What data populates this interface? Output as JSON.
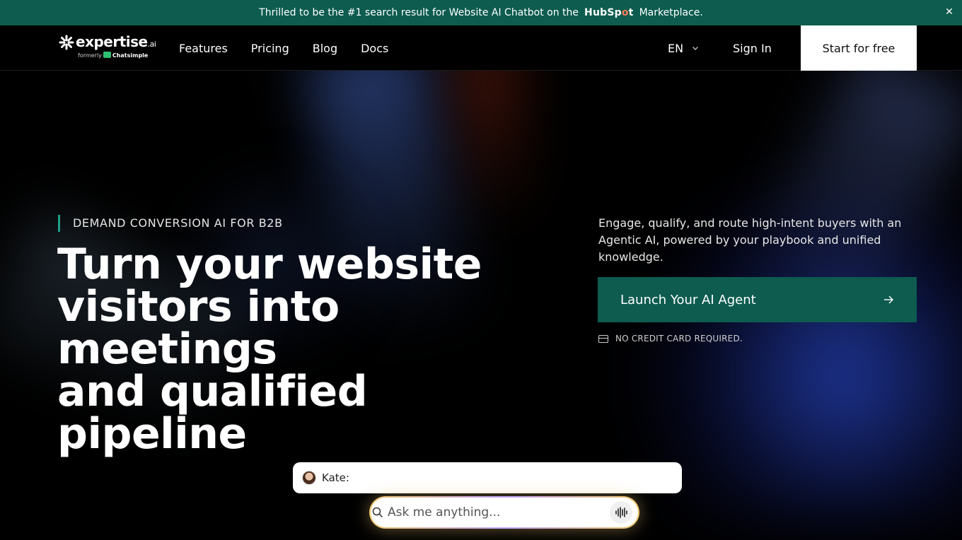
{
  "announcement": {
    "text_before": "Thrilled to be the #1 search result for Website AI Chatbot on the",
    "brand_a": "HubSp",
    "brand_b": "t",
    "text_after": "Marketplace."
  },
  "logo": {
    "name": "expertise",
    "suffix": ".ai",
    "formerly": "formerly",
    "former_name": "Chatsimple"
  },
  "nav": {
    "items": [
      {
        "label": "Features"
      },
      {
        "label": "Pricing"
      },
      {
        "label": "Blog"
      },
      {
        "label": "Docs"
      }
    ],
    "language": "EN",
    "signin": "Sign In",
    "cta": "Start for free"
  },
  "hero": {
    "eyebrow": "DEMAND CONVERSION AI FOR B2B",
    "headline_line1": "Turn your website",
    "headline_line2": "visitors into meetings",
    "headline_line3": "and qualified pipeline",
    "description": "Engage, qualify, and route high-intent buyers with an Agentic AI, powered by your playbook and unified knowledge.",
    "cta": "Launch Your AI Agent",
    "note": "NO CREDIT CARD REQUIRED."
  },
  "chat": {
    "agent_label": "Kate:",
    "input_placeholder": "Ask me anything..."
  },
  "colors": {
    "accent": "#0d5c4f",
    "eyebrow_bar": "#1e9f86",
    "hubspot_orange": "#ff7a59"
  }
}
